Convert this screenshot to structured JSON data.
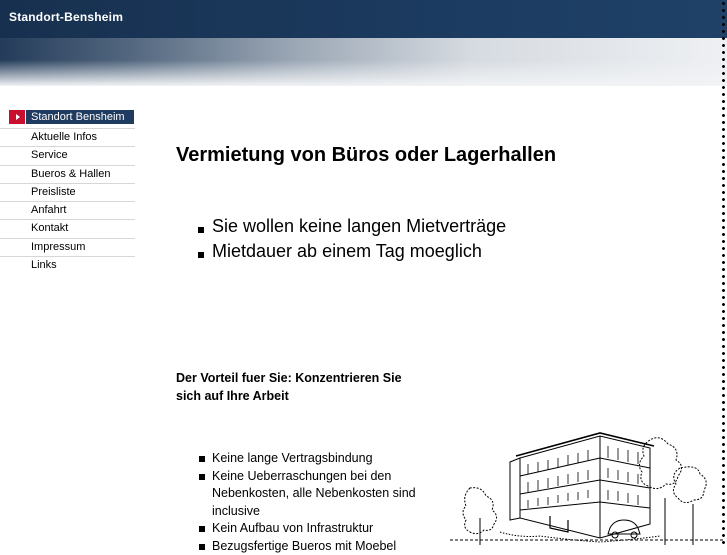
{
  "header": {
    "title": "Standort-Bensheim"
  },
  "nav": {
    "items": [
      {
        "label": "Standort Bensheim",
        "active": true
      },
      {
        "label": "Aktuelle Infos"
      },
      {
        "label": "Service"
      },
      {
        "label": "Bueros & Hallen"
      },
      {
        "label": "Preisliste"
      },
      {
        "label": "Anfahrt"
      },
      {
        "label": "Kontakt"
      },
      {
        "label": "Impressum"
      },
      {
        "label": "Links"
      }
    ]
  },
  "main": {
    "headline": "Vermietung von Büros oder Lagerhallen",
    "big_list": [
      "Sie wollen keine langen Mietverträge",
      "Mietdauer ab einem Tag moeglich"
    ],
    "subheading": "Der Vorteil fuer Sie: Konzentrieren Sie sich auf Ihre Arbeit",
    "small_list": [
      "Keine lange Vertragsbindung",
      "Keine Ueberraschungen bei den Nebenkosten, alle Nebenkosten sind inclusive",
      "Kein Aufbau von Infrastruktur",
      "Bezugsfertige Bueros mit Moebel"
    ]
  },
  "colors": {
    "header_dark": "#1c3b60",
    "nav_active_bg": "#1f3b5f",
    "nav_marker": "#c8102e"
  },
  "icons": {
    "nav_marker": "triangle-right-icon",
    "illustration": "office-building-sketch"
  }
}
